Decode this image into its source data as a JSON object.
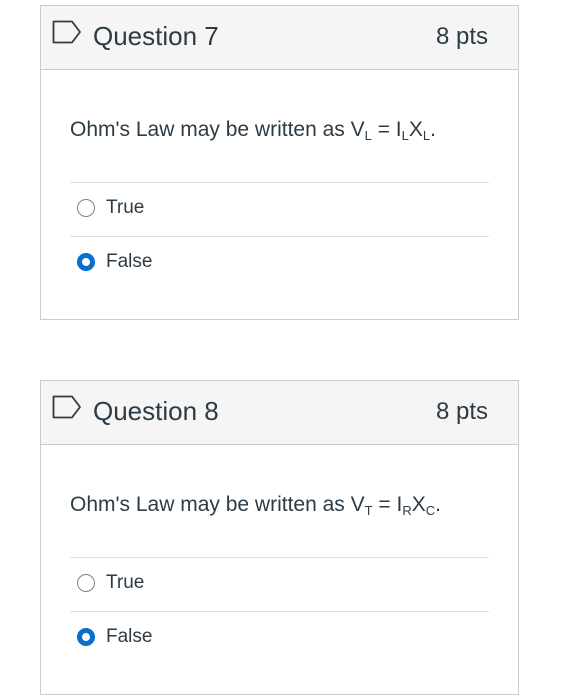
{
  "questions": [
    {
      "title": "Question 7",
      "points": "8 pts",
      "text_prefix": "Ohm's Law may be written as V",
      "sub_v": "L",
      "text_eq": " = I",
      "sub_i": "L",
      "text_x": "X",
      "sub_x": "L",
      "text_end": ".",
      "answers": [
        {
          "label": "True",
          "selected": false
        },
        {
          "label": "False",
          "selected": true
        }
      ]
    },
    {
      "title": "Question 8",
      "points": "8 pts",
      "text_prefix": "Ohm's Law may be written as V",
      "sub_v": "T",
      "text_eq": " = I",
      "sub_i": "R",
      "text_x": "X",
      "sub_x": "C",
      "text_end": ".",
      "answers": [
        {
          "label": "True",
          "selected": false
        },
        {
          "label": "False",
          "selected": true
        }
      ]
    }
  ],
  "colors": {
    "accent": "#0770cf",
    "border": "#c7cdd1",
    "header_bg": "#f5f5f5",
    "text": "#2d3b45"
  }
}
